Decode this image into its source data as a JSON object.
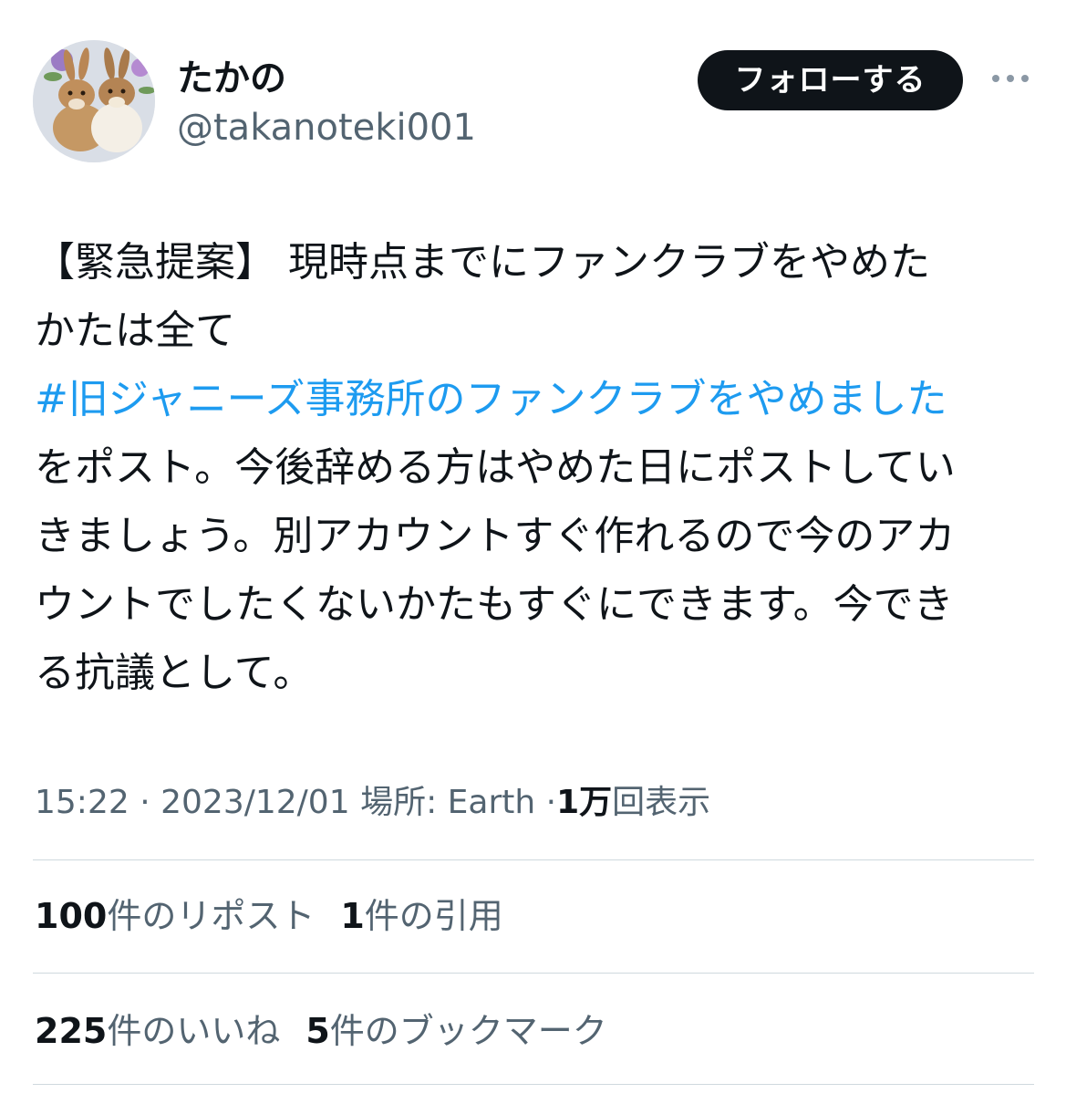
{
  "user": {
    "display_name": "たかの",
    "handle": "@takanoteki001",
    "avatar_icon": "rabbits-avatar"
  },
  "actions": {
    "follow_label": "フォローする",
    "more_icon": "more-horizontal-icon"
  },
  "tweet": {
    "lines": [
      "【緊急提案】 現時点までにファンクラブをやめた",
      "かたは全て",
      "#旧ジャニーズ事務所のファンクラブをやめました",
      "をポスト。今後辞める方はやめた日にポストしてい",
      "きましょう。別アカウントすぐ作れるので今のアカ",
      "ウントでしたくないかたもすぐにできます。今でき",
      "る抗議として。"
    ],
    "hashtag": "#旧ジャニーズ事務所のファンクラブをやめました"
  },
  "meta": {
    "time": "15:22",
    "separator": "·",
    "date": "2023/12/01",
    "location_label": "場所: Earth",
    "views_count": "1万",
    "views_label": "回表示"
  },
  "stats": {
    "reposts_count": "100",
    "reposts_label": "件のリポスト",
    "quotes_count": "1",
    "quotes_label": "件の引用",
    "likes_count": "225",
    "likes_label": "件のいいね",
    "bookmarks_count": "5",
    "bookmarks_label": "件のブックマーク"
  },
  "colors": {
    "hashtag": "#1d9bf0",
    "button_bg": "#0f1419",
    "secondary_text": "#536471",
    "divider": "#cfd9de"
  }
}
